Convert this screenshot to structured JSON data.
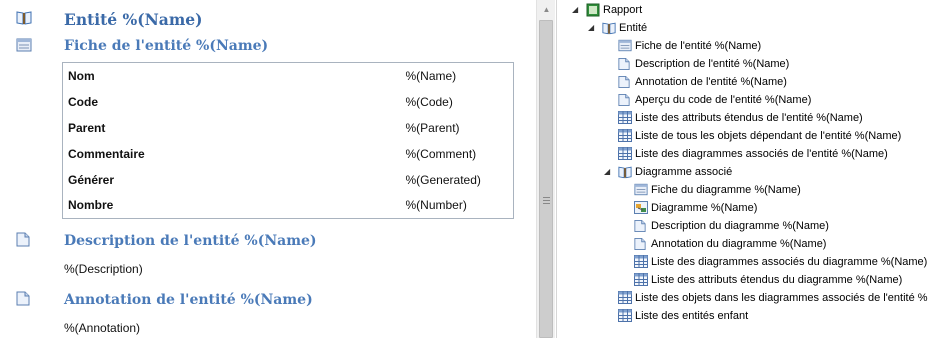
{
  "editor": {
    "title": "Entité %(Name)",
    "fiche_heading": "Fiche de l'entité %(Name)",
    "properties": [
      {
        "label": "Nom",
        "value": "%(Name)"
      },
      {
        "label": "Code",
        "value": "%(Code)"
      },
      {
        "label": "Parent",
        "value": "%(Parent)"
      },
      {
        "label": "Commentaire",
        "value": "%(Comment)"
      },
      {
        "label": "Générer",
        "value": "%(Generated)"
      },
      {
        "label": "Nombre",
        "value": "%(Number)"
      }
    ],
    "description_heading": "Description de l'entité %(Name)",
    "description_text": "%(Description)",
    "annotation_heading": "Annotation de l'entité %(Name)",
    "annotation_text": "%(Annotation)"
  },
  "tree": {
    "root": "Rapport",
    "entity": "Entité",
    "entity_items": [
      "Fiche de l'entité %(Name)",
      "Description de l'entité %(Name)",
      "Annotation de l'entité %(Name)",
      "Aperçu du code de l'entité %(Name)",
      "Liste des attributs étendus de l'entité %(Name)",
      "Liste de tous les objets dépendant de l'entité %(Name)",
      "Liste des diagrammes associés de l'entité %(Name)"
    ],
    "diagram_section": "Diagramme associé",
    "diagram_items": [
      "Fiche du diagramme %(Name)",
      "Diagramme %(Name)",
      "Description du diagramme %(Name)",
      "Annotation du diagramme %(Name)",
      "Liste des diagrammes associés du diagramme %(Name)",
      "Liste des attributs étendus du diagramme %(Name)"
    ],
    "tail_items": [
      "Liste des objets dans les diagrammes associés de l'entité %",
      "Liste des entités enfant"
    ]
  },
  "icons": {
    "entity_book": "book-icon",
    "fiche": "card-icon",
    "document": "document-icon",
    "list": "list-grid-icon",
    "diagram": "diagram-icon",
    "report": "report-icon"
  },
  "colors": {
    "heading": "#4a7ab8",
    "title": "#3b6aa8",
    "table_border": "#a9b3bf"
  }
}
